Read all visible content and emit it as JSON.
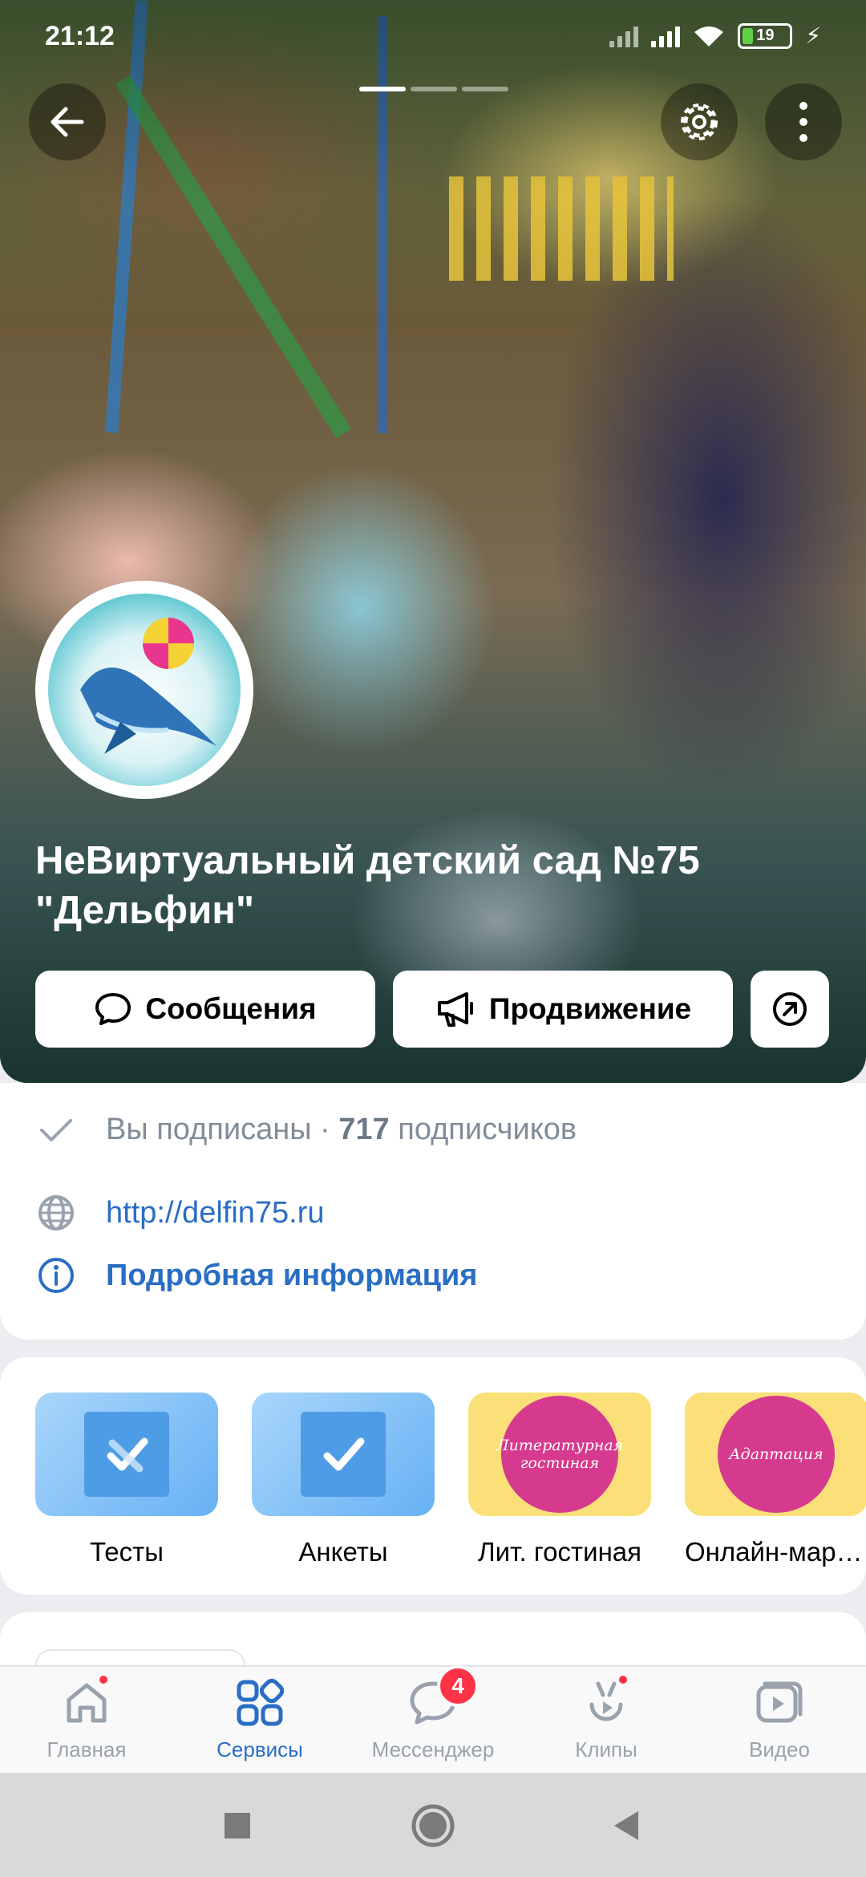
{
  "status_bar": {
    "time": "21:12",
    "battery": "19"
  },
  "cover": {
    "slide_count": 3,
    "active_slide": 1
  },
  "group": {
    "title": "НеВиртуальный детский сад №75 \"Дельфин\""
  },
  "actions": {
    "messages_label": "Сообщения",
    "promotion_label": "Продвижение"
  },
  "info": {
    "subscribed": "Вы подписаны · ",
    "subscribers_count": "717",
    "subscribers_suffix": " подписчиков",
    "website": "http://delfin75.ru",
    "details_link": "Подробная информация"
  },
  "services": [
    {
      "label": "Тесты",
      "icon": "tests-check-icon"
    },
    {
      "label": "Анкеты",
      "icon": "forms-check-icon"
    },
    {
      "label": "Лит. гостиная",
      "icon_text": "Литературная гостиная"
    },
    {
      "label": "Онлайн-мара...",
      "icon_text": "Адаптация"
    }
  ],
  "tabbar": {
    "items": [
      {
        "label": "Главная",
        "icon": "home-icon",
        "has_dot": true
      },
      {
        "label": "Сервисы",
        "icon": "services-grid-icon",
        "active": true
      },
      {
        "label": "Мессенджер",
        "icon": "messenger-icon",
        "badge": "4"
      },
      {
        "label": "Клипы",
        "icon": "clips-icon",
        "has_dot": true
      },
      {
        "label": "Видео",
        "icon": "video-icon"
      }
    ]
  },
  "colors": {
    "accent": "#2a6ec4",
    "badge": "#ff3347",
    "text_secondary": "#818c99"
  }
}
